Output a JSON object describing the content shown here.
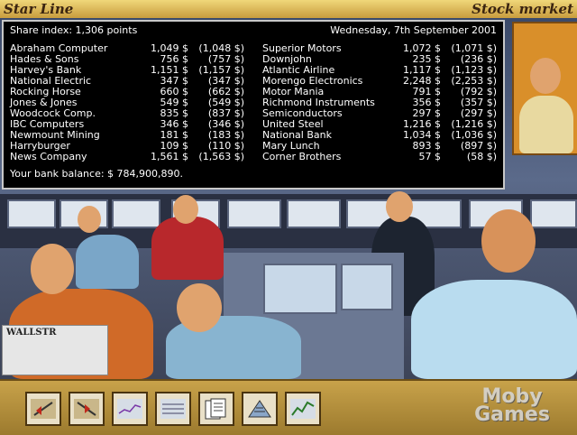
{
  "titlebar": {
    "left": "Star Line",
    "right": "Stock market"
  },
  "panel": {
    "share_index": "Share index: 1,306 points",
    "date": "Wednesday, 7th September 2001",
    "balance": "Your bank balance: $ 784,900,890.",
    "left": [
      {
        "name": "Abraham Computer",
        "value": "1,049 $",
        "change": "(1,048 $)"
      },
      {
        "name": "Hades & Sons",
        "value": "756 $",
        "change": "(757 $)"
      },
      {
        "name": "Harvey's Bank",
        "value": "1,151 $",
        "change": "(1,157 $)"
      },
      {
        "name": "National Electric",
        "value": "347 $",
        "change": "(347 $)"
      },
      {
        "name": "Rocking Horse",
        "value": "660 $",
        "change": "(662 $)"
      },
      {
        "name": "Jones & Jones",
        "value": "549 $",
        "change": "(549 $)"
      },
      {
        "name": "Woodcock Comp.",
        "value": "835 $",
        "change": "(837 $)"
      },
      {
        "name": "IBC Computers",
        "value": "346 $",
        "change": "(346 $)"
      },
      {
        "name": "Newmount Mining",
        "value": "181 $",
        "change": "(183 $)"
      },
      {
        "name": "Harryburger",
        "value": "109 $",
        "change": "(110 $)"
      },
      {
        "name": "News Company",
        "value": "1,561 $",
        "change": "(1,563 $)"
      }
    ],
    "right": [
      {
        "name": "Superior Motors",
        "value": "1,072 $",
        "change": "(1,071 $)"
      },
      {
        "name": "Downjohn",
        "value": "235 $",
        "change": "(236 $)"
      },
      {
        "name": "Atlantic Airline",
        "value": "1,117 $",
        "change": "(1,123 $)"
      },
      {
        "name": "Morengo Electronics",
        "value": "2,248 $",
        "change": "(2,253 $)"
      },
      {
        "name": "Motor Mania",
        "value": "791 $",
        "change": "(792 $)"
      },
      {
        "name": "Richmond Instruments",
        "value": "356 $",
        "change": "(357 $)"
      },
      {
        "name": "Semiconductors",
        "value": "297 $",
        "change": "(297 $)"
      },
      {
        "name": "United Steel",
        "value": "1,216 $",
        "change": "(1,216 $)"
      },
      {
        "name": "National Bank",
        "value": "1,034 $",
        "change": "(1,036 $)"
      },
      {
        "name": "Mary Lunch",
        "value": "893 $",
        "change": "(897 $)"
      },
      {
        "name": "Corner Brothers",
        "value": "57 $",
        "change": "(58 $)"
      }
    ]
  },
  "newspaper_text": "WALLSTR",
  "toolbar": {
    "tools": [
      {
        "icon": "buy-shares-icon"
      },
      {
        "icon": "sell-shares-icon"
      },
      {
        "icon": "chart-line-icon"
      },
      {
        "icon": "stock-table-icon"
      },
      {
        "icon": "documents-icon"
      },
      {
        "icon": "building-icon"
      },
      {
        "icon": "trend-graph-icon"
      }
    ],
    "watermark": "Moby Games"
  },
  "colors": {
    "panel_bg": "#000000",
    "panel_text": "#ffffff",
    "frame": "#b08c3a"
  }
}
